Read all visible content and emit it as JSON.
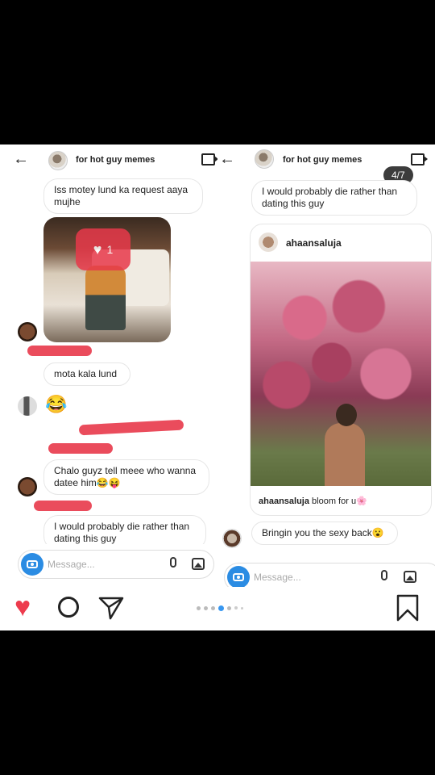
{
  "left_panel": {
    "header": {
      "title": "for hot guy memes"
    },
    "messages": [
      {
        "text": "Iss motey lund ka request aaya mujhe"
      },
      {
        "like_count": "1"
      },
      {
        "text": "mota kala lund"
      },
      {
        "emoji": "😂"
      },
      {
        "text": "Chalo guyz tell meee who wanna datee him😂😝"
      },
      {
        "text": "I would probably die rather than dating this guy"
      }
    ],
    "input": {
      "placeholder": "Message..."
    }
  },
  "right_panel": {
    "header": {
      "title": "for hot guy memes"
    },
    "page_badge": "4/7",
    "messages": [
      {
        "text": "I would probably die rather than dating this guy"
      },
      {
        "post_username": "ahaansaluja",
        "caption_user": "ahaansaluja",
        "caption_text": " bloom for u🌸"
      },
      {
        "text": "Bringin you the sexy back😮"
      }
    ],
    "input": {
      "placeholder": "Message..."
    }
  },
  "bottom_bar": {
    "icons": [
      "heart-icon",
      "comment-icon",
      "send-icon",
      "bookmark-icon"
    ],
    "carousel_dots": 7,
    "active_dot": 3
  },
  "colors": {
    "like_red": "#e8394a",
    "camera_blue": "#2b8ce3",
    "badge_bg": "#3c3c3c"
  }
}
